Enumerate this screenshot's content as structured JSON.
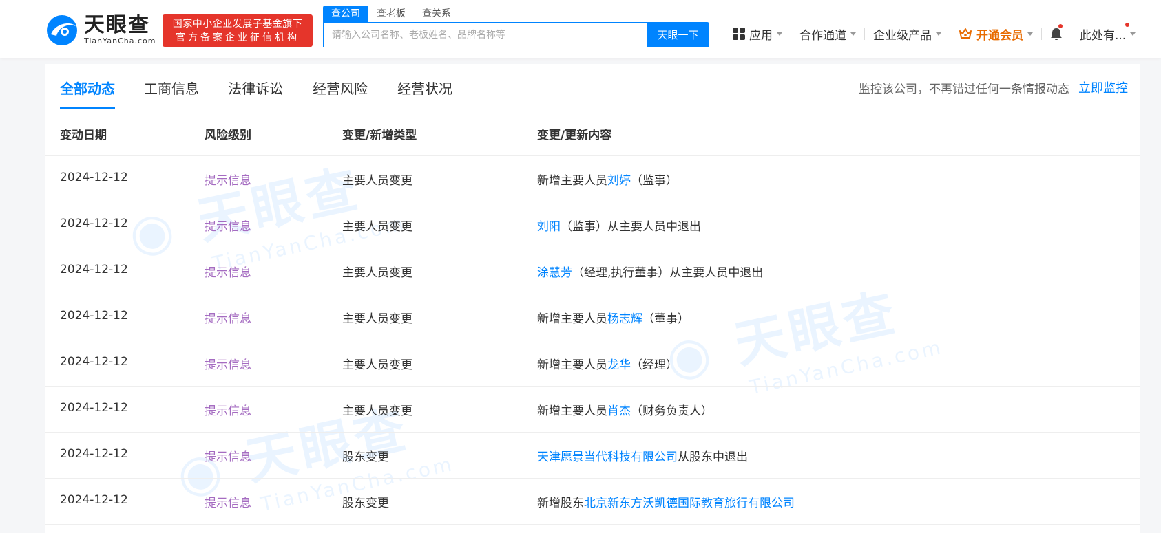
{
  "header": {
    "logo_cn": "天眼查",
    "logo_en": "TianYanCha.com",
    "badge_line1": "国家中小企业发展子基金旗下",
    "badge_line2": "官方备案企业征信机构",
    "search_tabs": [
      "查公司",
      "查老板",
      "查关系"
    ],
    "search_placeholder": "请输入公司名称、老板姓名、品牌名称等",
    "search_button": "天眼一下",
    "nav": {
      "apps": "应用",
      "cooperation": "合作通道",
      "enterprise": "企业级产品",
      "vip": "开通会员",
      "user": "此处有..."
    },
    "colors": {
      "brand": "#0084ff",
      "badge": "#e5352b",
      "vip": "#e86b00"
    }
  },
  "tabs": [
    "全部动态",
    "工商信息",
    "法律诉讼",
    "经营风险",
    "经营状况"
  ],
  "monitor": {
    "text": "监控该公司，不再错过任何一条情报动态",
    "link": "立即监控"
  },
  "table": {
    "headers": [
      "变动日期",
      "风险级别",
      "变更/新增类型",
      "变更/更新内容"
    ],
    "rows": [
      {
        "date": "2024-12-12",
        "risk": "提示信息",
        "type": "主要人员变更",
        "pre": "新增主要人员",
        "name": "刘婷",
        "post": "（监事）"
      },
      {
        "date": "2024-12-12",
        "risk": "提示信息",
        "type": "主要人员变更",
        "pre": "",
        "name": "刘阳",
        "post": "（监事）从主要人员中退出"
      },
      {
        "date": "2024-12-12",
        "risk": "提示信息",
        "type": "主要人员变更",
        "pre": "",
        "name": "涂慧芳",
        "post": "（经理,执行董事）从主要人员中退出"
      },
      {
        "date": "2024-12-12",
        "risk": "提示信息",
        "type": "主要人员变更",
        "pre": "新增主要人员",
        "name": "杨志辉",
        "post": "（董事）"
      },
      {
        "date": "2024-12-12",
        "risk": "提示信息",
        "type": "主要人员变更",
        "pre": "新增主要人员",
        "name": "龙华",
        "post": "（经理）"
      },
      {
        "date": "2024-12-12",
        "risk": "提示信息",
        "type": "主要人员变更",
        "pre": "新增主要人员",
        "name": "肖杰",
        "post": "（财务负责人）"
      },
      {
        "date": "2024-12-12",
        "risk": "提示信息",
        "type": "股东变更",
        "pre": "",
        "name": "天津愿景当代科技有限公司",
        "post": "从股东中退出"
      },
      {
        "date": "2024-12-12",
        "risk": "提示信息",
        "type": "股东变更",
        "pre": "新增股东",
        "name": "北京新东方沃凯德国际教育旅行有限公司",
        "post": ""
      }
    ]
  }
}
